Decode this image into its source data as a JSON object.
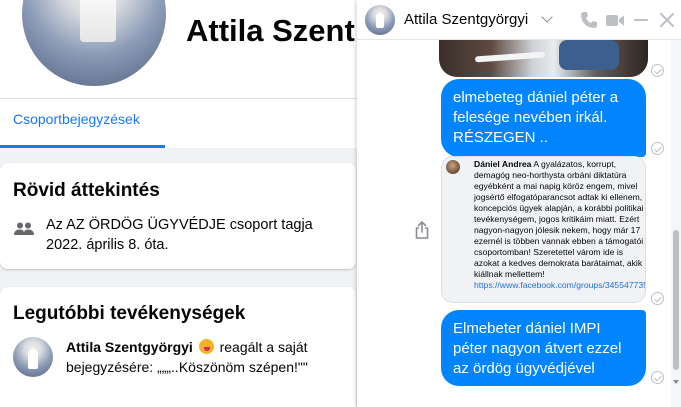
{
  "profile": {
    "name": "Attila Szent",
    "tab": "Csoportbejegyzések"
  },
  "overview": {
    "title": "Rövid áttekintés",
    "prefix": "Az",
    "group": "AZ ÖRDÖG ÜGYVÉDJE",
    "suffix": "csoport tagja",
    "since": "2022. április 8. óta."
  },
  "activity": {
    "title": "Legutóbbi tevékenységek",
    "actor": "Attila Szentgyörgyi",
    "action": "reagált a saját",
    "detail": "bejegyzésére: „„„..Köszönöm szépen!\"\""
  },
  "chat": {
    "name": "Attila Szentgyörgyi",
    "icons": [
      "chevron-down-icon",
      "phone-icon",
      "video-icon",
      "minimize-icon",
      "close-icon"
    ],
    "messages": [
      {
        "type": "photo"
      },
      {
        "type": "text",
        "text": "elmebeteg dániel péter a felesége nevében irkál. RÉSZEGEN .."
      },
      {
        "type": "screenshot",
        "author": "Dániel Andrea",
        "body": "A gyalázatos, korrupt, demagóg neo-horthysta orbáni diktatúra egyébként a mai napig köröz engem, mivel jogsértő elfogatóparancsot adtak ki ellenem, koncepciós ügyek alapján, a korábbi politikai tevékenységem, jogos kritikáim miatt. Ezért nagyon-nagyon jólesik nekem, hogy már 17 ezernél is többen vannak ebben a támogatói csoportomban! Szeretettel várom ide is azokat a kedves demokrata barátaimat, akik kiállnak mellettem!",
        "link": "https://www.facebook.com/groups/345547735515199/"
      },
      {
        "type": "text",
        "text": "Elmebeter dániel IMPI péter nagyon átvert ezzel az ördög ügyvédjével"
      }
    ]
  },
  "colors": {
    "accent": "#1877f2",
    "bubble": "#0084ff"
  }
}
